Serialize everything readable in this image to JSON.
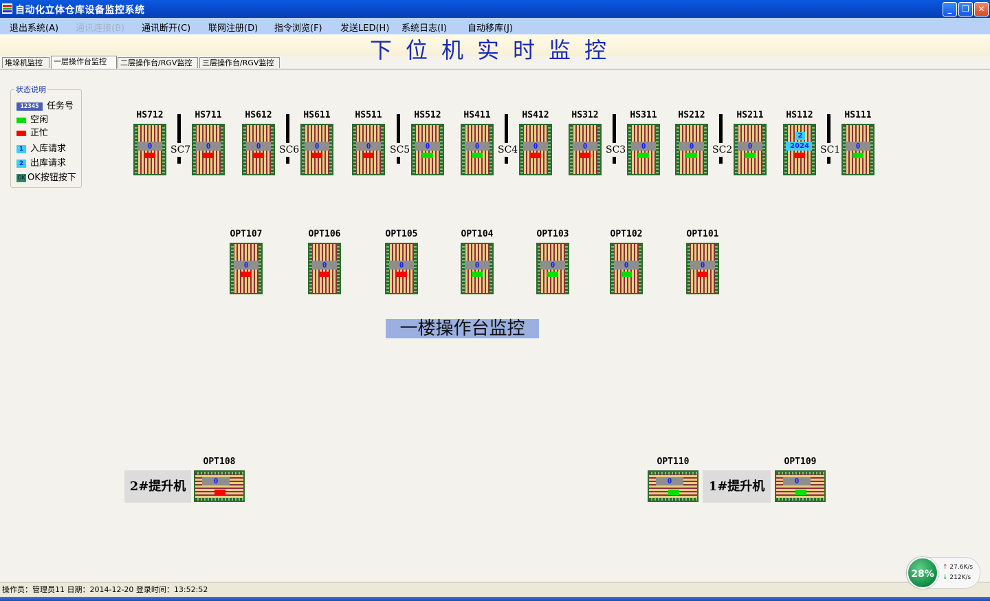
{
  "window": {
    "title": "自动化立体仓库设备监控系统"
  },
  "menu": [
    "退出系统(A)",
    "通讯连接(B)",
    "通讯断开(C)",
    "联网注册(D)",
    "指令浏览(F)",
    "发送LED(H)",
    "系统日志(I)",
    "自动移库(J)"
  ],
  "menu_disabled_index": 1,
  "banner": "下位机实时监控",
  "tabs": [
    "堆垛机监控",
    "一层操作台监控",
    "二层操作台/RGV监控",
    "三层操作台/RGV监控"
  ],
  "active_tab": 1,
  "legend": {
    "title": "状态说明",
    "items": [
      {
        "swatch": "12345",
        "label": "任务号"
      },
      {
        "swatch": "",
        "label": "空闲"
      },
      {
        "swatch": "",
        "label": "正忙"
      },
      {
        "swatch": "1",
        "label": "入库请求"
      },
      {
        "swatch": "2",
        "label": "出库请求"
      },
      {
        "swatch": "OK",
        "label": "OK按钮按下"
      }
    ]
  },
  "colors": {
    "idle": "#00e000",
    "busy": "#ff0000",
    "request": "#3ad0f0",
    "task_bg": "#4a5fb8"
  },
  "hs_stations": [
    {
      "name": "HS712",
      "task": "0",
      "status": "busy"
    },
    {
      "name": "HS711",
      "task": "0",
      "status": "busy"
    },
    {
      "name": "HS612",
      "task": "0",
      "status": "busy"
    },
    {
      "name": "HS611",
      "task": "0",
      "status": "busy"
    },
    {
      "name": "HS511",
      "task": "0",
      "status": "busy"
    },
    {
      "name": "HS512",
      "task": "0",
      "status": "idle"
    },
    {
      "name": "HS411",
      "task": "0",
      "status": "idle"
    },
    {
      "name": "HS412",
      "task": "0",
      "status": "busy"
    },
    {
      "name": "HS312",
      "task": "0",
      "status": "busy"
    },
    {
      "name": "HS311",
      "task": "0",
      "status": "idle"
    },
    {
      "name": "HS212",
      "task": "0",
      "status": "idle"
    },
    {
      "name": "HS211",
      "task": "0",
      "status": "idle"
    },
    {
      "name": "HS112",
      "task": "2024",
      "status": "busy",
      "request": "2"
    },
    {
      "name": "HS111",
      "task": "0",
      "status": "idle"
    }
  ],
  "stackers": [
    "SC7",
    "SC6",
    "SC5",
    "SC4",
    "SC3",
    "SC2",
    "SC1"
  ],
  "opt_stations": [
    {
      "name": "OPT107",
      "task": "0",
      "status": "busy"
    },
    {
      "name": "OPT106",
      "task": "0",
      "status": "busy"
    },
    {
      "name": "OPT105",
      "task": "0",
      "status": "busy"
    },
    {
      "name": "OPT104",
      "task": "0",
      "status": "idle"
    },
    {
      "name": "OPT103",
      "task": "0",
      "status": "idle"
    },
    {
      "name": "OPT102",
      "task": "0",
      "status": "idle"
    },
    {
      "name": "OPT101",
      "task": "0",
      "status": "busy"
    }
  ],
  "section_title": "一楼操作台监控",
  "lifts": {
    "left": {
      "label": "2#提升机",
      "opt": {
        "name": "OPT108",
        "task": "0",
        "status": "busy"
      }
    },
    "right": {
      "label": "1#提升机",
      "opt_left": {
        "name": "OPT110",
        "task": "0",
        "status": "idle"
      },
      "opt_right": {
        "name": "OPT109",
        "task": "0",
        "status": "idle"
      }
    }
  },
  "status_bar": "操作员：管理员11 日期：2014-12-20 登录时间：13:52:52",
  "net_meter": {
    "percent": "28%",
    "up": "27.6K/s",
    "down": "212K/s"
  }
}
